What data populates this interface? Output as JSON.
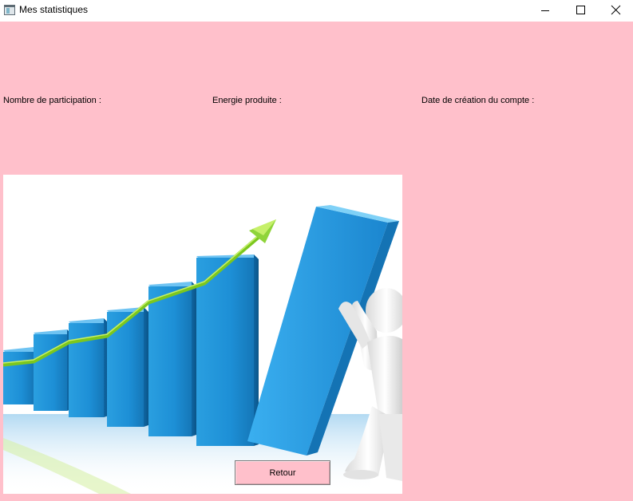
{
  "window": {
    "title": "Mes statistiques",
    "icon": "app-window-icon",
    "background": "#ffc0cb"
  },
  "controls": {
    "minimize_icon": "minimize-icon",
    "maximize_icon": "maximize-icon",
    "close_icon": "close-icon"
  },
  "labels": {
    "participation": "Nombre de participation :",
    "energie": "Energie produite :",
    "date_creation": "Date de création du compte :"
  },
  "illustration": {
    "description_icon": "growth-chart-illustration-icon"
  },
  "actions": {
    "retour_label": "Retour"
  }
}
